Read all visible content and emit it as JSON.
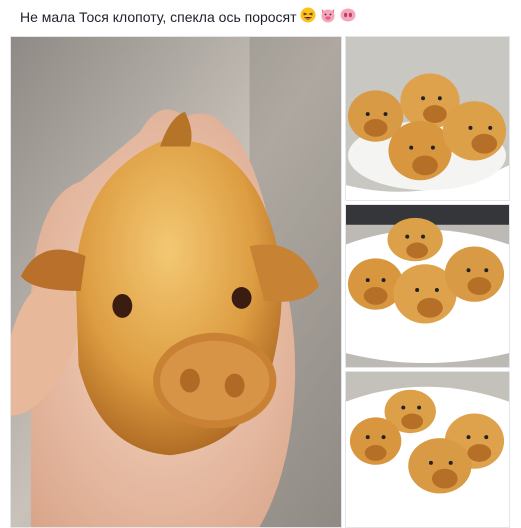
{
  "post": {
    "text": "Не мала Тося клопоту, спекла ось поросят",
    "emoji": [
      "grinning-squinting-face",
      "pig-face",
      "pig-nose"
    ]
  },
  "photos": [
    {
      "name": "hand-held-pig-bun"
    },
    {
      "name": "pig-buns-plate-1"
    },
    {
      "name": "pig-buns-plate-2"
    },
    {
      "name": "pig-buns-plate-3"
    }
  ],
  "colors": {
    "text": "#1d2129",
    "bun": "#d99a3c",
    "bun_dark": "#a8621e",
    "hand": "#f0c8b0",
    "background": "#b8b2aa"
  }
}
